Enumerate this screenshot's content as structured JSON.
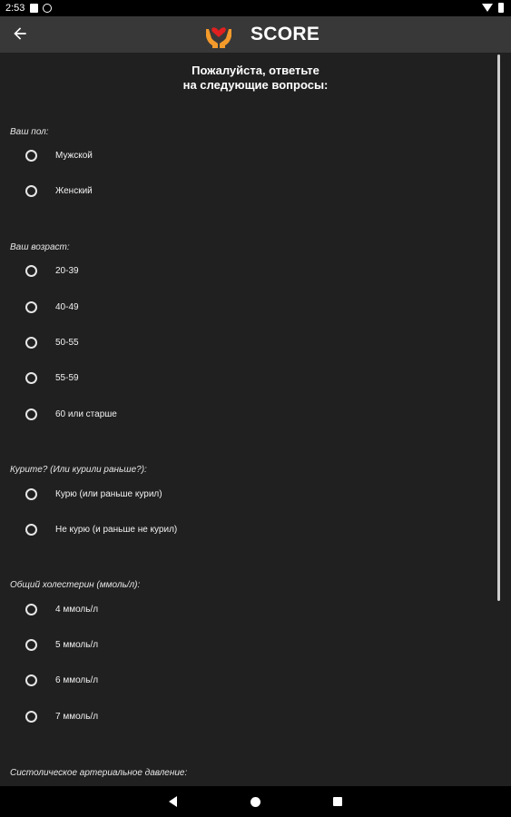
{
  "status": {
    "time": "2:53"
  },
  "appbar": {
    "title": "SCORE"
  },
  "heading": {
    "line1": "Пожалуйста, ответьте",
    "line2": "на следующие вопросы:"
  },
  "questions": [
    {
      "label": "Ваш пол:",
      "options": [
        "Мужской",
        "Женский"
      ]
    },
    {
      "label": "Ваш возраст:",
      "options": [
        "20-39",
        "40-49",
        "50-55",
        "55-59",
        "60 или старше"
      ]
    },
    {
      "label": "Курите? (Или курили раньше?):",
      "options": [
        "Курю (или раньше курил)",
        "Не курю (и раньше не курил)"
      ]
    },
    {
      "label": "Общий холестерин (ммоль/л):",
      "options": [
        "4 ммоль/л",
        "5 ммоль/л",
        "6 ммоль/л",
        "7 ммоль/л"
      ]
    },
    {
      "label": "Систолическое артериальное давление:",
      "options": []
    }
  ],
  "colors": {
    "background": "#202020",
    "appbar": "#383838",
    "logo_hands": "#f39a2b",
    "logo_heart": "#e02020"
  },
  "icons": {
    "back": "arrow-left-icon",
    "logo": "heart-in-hands-icon"
  }
}
